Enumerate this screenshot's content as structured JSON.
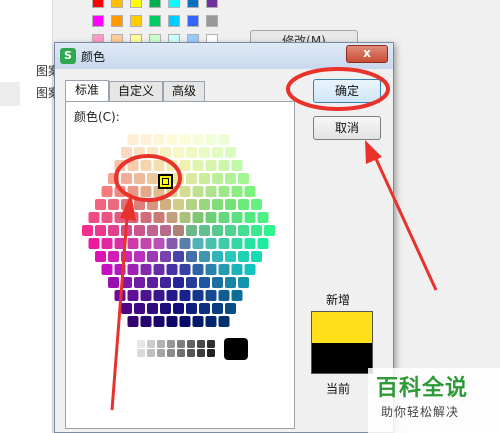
{
  "background_window": {
    "modify_button": "修改(M)",
    "labels": [
      "图案",
      "图案"
    ],
    "swatch_colors": [
      [
        "#ff0000",
        "#ffc000",
        "#ffff00",
        "#00b050",
        "#00ffff",
        "#0070c0",
        "#7030a0"
      ],
      [
        "#ff00ff",
        "#ff9900",
        "#ffcc00",
        "#00cc66",
        "#00ccff",
        "#3366ff",
        "#999999"
      ],
      [
        "#ff99cc",
        "#ffcc99",
        "#ffff99",
        "#ccffcc",
        "#ccffff",
        "#99ccff",
        "#ffffff"
      ]
    ]
  },
  "dialog": {
    "title": "颜色",
    "app_icon_letter": "S",
    "close_glyph": "x",
    "tabs": [
      {
        "label": "标准",
        "active": true
      },
      {
        "label": "自定义",
        "active": false
      },
      {
        "label": "高级",
        "active": false
      }
    ],
    "colors_label": "颜色(C):",
    "ok_label": "确定",
    "cancel_label": "取消",
    "new_label": "新增",
    "current_label": "当前",
    "new_color": "#ffe01b",
    "current_color": "#000000",
    "selected_color": "#ffff00"
  },
  "watermark": {
    "title": "百科全说",
    "subtitle": "助你轻松解决"
  },
  "annotation_color": "#e8322a"
}
